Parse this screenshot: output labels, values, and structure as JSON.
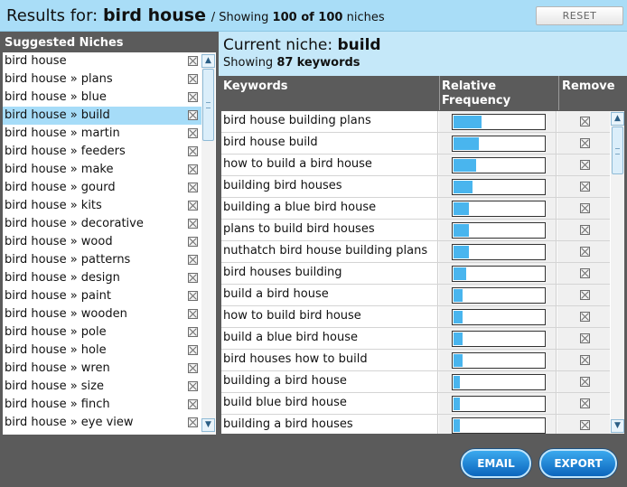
{
  "header": {
    "results_label": "Results for:",
    "query": "bird house",
    "showing_prefix": "/ Showing",
    "showing_count": "100 of 100",
    "showing_suffix": "niches",
    "reset_label": "RESET"
  },
  "sidebar": {
    "title": "Suggested Niches",
    "selected_index": 3,
    "items": [
      {
        "label": "bird house"
      },
      {
        "label": "bird house » plans"
      },
      {
        "label": "bird house » blue"
      },
      {
        "label": "bird house » build"
      },
      {
        "label": "bird house » martin"
      },
      {
        "label": "bird house » feeders"
      },
      {
        "label": "bird house » make"
      },
      {
        "label": "bird house » gourd"
      },
      {
        "label": "bird house » kits"
      },
      {
        "label": "bird house » decorative"
      },
      {
        "label": "bird house » wood"
      },
      {
        "label": "bird house » patterns"
      },
      {
        "label": "bird house » design"
      },
      {
        "label": "bird house » paint"
      },
      {
        "label": "bird house » wooden"
      },
      {
        "label": "bird house » pole"
      },
      {
        "label": "bird house » hole"
      },
      {
        "label": "bird house » wren"
      },
      {
        "label": "bird house » size"
      },
      {
        "label": "bird house » finch"
      },
      {
        "label": "bird house » eye view"
      }
    ]
  },
  "niche": {
    "current_label": "Current niche:",
    "current_name": "build",
    "showing_label": "Showing",
    "keyword_count": "87",
    "keywords_word": "keywords"
  },
  "table": {
    "col_keywords": "Keywords",
    "col_frequency": "Relative Frequency",
    "col_remove": "Remove",
    "rows": [
      {
        "keyword": "bird house building plans",
        "frequency": 0.31
      },
      {
        "keyword": "bird house build",
        "frequency": 0.28
      },
      {
        "keyword": "how to build a bird house",
        "frequency": 0.25
      },
      {
        "keyword": "building bird houses",
        "frequency": 0.21
      },
      {
        "keyword": "building a blue bird house",
        "frequency": 0.17
      },
      {
        "keyword": "plans to build bird houses",
        "frequency": 0.17
      },
      {
        "keyword": "nuthatch bird house building plans",
        "frequency": 0.17
      },
      {
        "keyword": "bird houses building",
        "frequency": 0.14
      },
      {
        "keyword": "build a bird house",
        "frequency": 0.1
      },
      {
        "keyword": "how to build bird house",
        "frequency": 0.1
      },
      {
        "keyword": "build a blue bird house",
        "frequency": 0.1
      },
      {
        "keyword": "bird houses how to build",
        "frequency": 0.1
      },
      {
        "keyword": "building a bird house",
        "frequency": 0.07
      },
      {
        "keyword": "build blue bird house",
        "frequency": 0.07
      },
      {
        "keyword": "building a bird houses",
        "frequency": 0.07
      }
    ]
  },
  "footer": {
    "email_label": "EMAIL",
    "export_label": "EXPORT"
  },
  "icons": {
    "remove": "close-box-icon",
    "scroll_up": "arrow-up-icon",
    "scroll_down": "arrow-down-icon"
  },
  "colors": {
    "accent": "#49b5ee",
    "header_bg": "#a9ddf7",
    "selected_bg": "#a6dcf8",
    "panel_bg": "#5b5b5b"
  }
}
